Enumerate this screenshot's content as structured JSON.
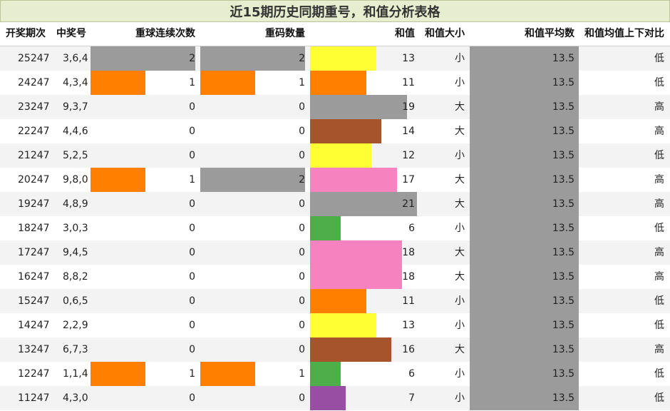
{
  "title": "近15期历史同期重号，和值分析表格",
  "headers": {
    "period": "开奖期次",
    "number": "中奖号",
    "repeat_streak": "重球连续次数",
    "repeat_count": "重码数量",
    "sum": "和值",
    "size": "和值大小",
    "avg": "和值平均数",
    "compare": "和值均值上下对比"
  },
  "colors": {
    "gray": "#9b9b9b",
    "orange": "#ff8000",
    "yellow": "#ffff33",
    "brown": "#a5542b",
    "pink": "#f782c0",
    "green": "#4daf4a",
    "purple": "#984ea3"
  },
  "rows": [
    {
      "period": "25247",
      "number": "3,6,4",
      "repeat_streak": 2,
      "repeat_count": 2,
      "sum": 13,
      "size": "小",
      "avg": "13.5",
      "compare": "低",
      "sum_color": "yellow"
    },
    {
      "period": "24247",
      "number": "4,3,4",
      "repeat_streak": 1,
      "repeat_count": 1,
      "sum": 11,
      "size": "小",
      "avg": "13.5",
      "compare": "低",
      "sum_color": "orange"
    },
    {
      "period": "23247",
      "number": "9,3,7",
      "repeat_streak": 0,
      "repeat_count": 0,
      "sum": 19,
      "size": "大",
      "avg": "13.5",
      "compare": "高",
      "sum_color": "gray"
    },
    {
      "period": "22247",
      "number": "4,4,6",
      "repeat_streak": 0,
      "repeat_count": 0,
      "sum": 14,
      "size": "大",
      "avg": "13.5",
      "compare": "高",
      "sum_color": "brown"
    },
    {
      "period": "21247",
      "number": "5,2,5",
      "repeat_streak": 0,
      "repeat_count": 0,
      "sum": 12,
      "size": "小",
      "avg": "13.5",
      "compare": "低",
      "sum_color": "yellow"
    },
    {
      "period": "20247",
      "number": "9,8,0",
      "repeat_streak": 1,
      "repeat_count": 2,
      "sum": 17,
      "size": "大",
      "avg": "13.5",
      "compare": "高",
      "sum_color": "pink"
    },
    {
      "period": "19247",
      "number": "4,8,9",
      "repeat_streak": 0,
      "repeat_count": 0,
      "sum": 21,
      "size": "大",
      "avg": "13.5",
      "compare": "高",
      "sum_color": "gray"
    },
    {
      "period": "18247",
      "number": "3,0,3",
      "repeat_streak": 0,
      "repeat_count": 0,
      "sum": 6,
      "size": "小",
      "avg": "13.5",
      "compare": "低",
      "sum_color": "green"
    },
    {
      "period": "17247",
      "number": "9,4,5",
      "repeat_streak": 0,
      "repeat_count": 0,
      "sum": 18,
      "size": "大",
      "avg": "13.5",
      "compare": "高",
      "sum_color": "pink"
    },
    {
      "period": "16247",
      "number": "8,8,2",
      "repeat_streak": 0,
      "repeat_count": 0,
      "sum": 18,
      "size": "大",
      "avg": "13.5",
      "compare": "高",
      "sum_color": "pink"
    },
    {
      "period": "15247",
      "number": "0,6,5",
      "repeat_streak": 0,
      "repeat_count": 0,
      "sum": 11,
      "size": "小",
      "avg": "13.5",
      "compare": "低",
      "sum_color": "orange"
    },
    {
      "period": "14247",
      "number": "2,2,9",
      "repeat_streak": 0,
      "repeat_count": 0,
      "sum": 13,
      "size": "小",
      "avg": "13.5",
      "compare": "低",
      "sum_color": "yellow"
    },
    {
      "period": "13247",
      "number": "6,7,3",
      "repeat_streak": 0,
      "repeat_count": 0,
      "sum": 16,
      "size": "大",
      "avg": "13.5",
      "compare": "高",
      "sum_color": "brown"
    },
    {
      "period": "12247",
      "number": "1,1,4",
      "repeat_streak": 1,
      "repeat_count": 1,
      "sum": 6,
      "size": "小",
      "avg": "13.5",
      "compare": "低",
      "sum_color": "green"
    },
    {
      "period": "11247",
      "number": "4,3,0",
      "repeat_streak": 0,
      "repeat_count": 0,
      "sum": 7,
      "size": "小",
      "avg": "13.5",
      "compare": "低",
      "sum_color": "purple"
    }
  ]
}
